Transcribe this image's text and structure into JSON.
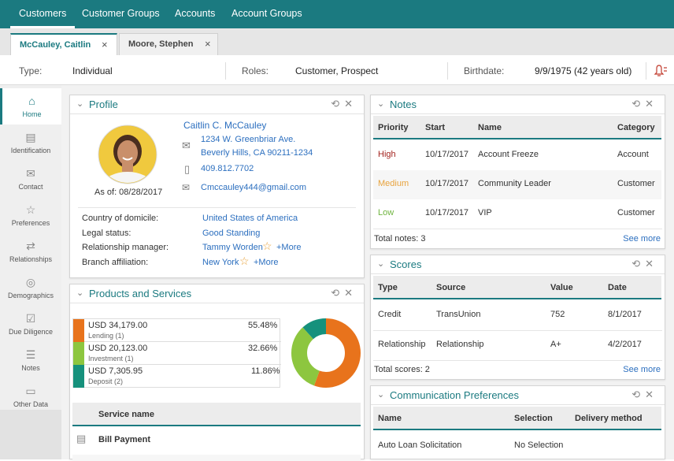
{
  "topnav": {
    "items": [
      "Customers",
      "Customer Groups",
      "Accounts",
      "Account Groups"
    ]
  },
  "record_tabs": [
    {
      "label": "McCauley, Caitlin",
      "close": "×"
    },
    {
      "label": "Moore, Stephen",
      "close": "×"
    }
  ],
  "infobar": {
    "type_label": "Type:",
    "type_value": "Individual",
    "roles_label": "Roles:",
    "roles_value": "Customer, Prospect",
    "birth_label": "Birthdate:",
    "birth_value": "9/9/1975 (42 years old)",
    "alert_icon": "bell-alert-icon"
  },
  "sidebar": {
    "items": [
      {
        "label": "Home",
        "icon": "home-icon"
      },
      {
        "label": "Identification",
        "icon": "id-card-icon"
      },
      {
        "label": "Contact",
        "icon": "address-icon"
      },
      {
        "label": "Preferences",
        "icon": "star-icon"
      },
      {
        "label": "Relationships",
        "icon": "arrows-icon"
      },
      {
        "label": "Demographics",
        "icon": "target-icon"
      },
      {
        "label": "Due Diligence",
        "icon": "checklist-icon"
      },
      {
        "label": "Notes",
        "icon": "notes-icon"
      },
      {
        "label": "Other Data",
        "icon": "folder-icon"
      }
    ]
  },
  "profile": {
    "title": "Profile",
    "name": "Caitlin C. McCauley",
    "address1": "1234 W. Greenbriar Ave.",
    "address2": "Beverly Hills, CA 90211-1234",
    "phone": "409.812.7702",
    "email": "Cmccauley444@gmail.com",
    "as_of": "As of: 08/28/2017",
    "fields": [
      {
        "label": "Country of domicile:",
        "value": "United States of America",
        "more": ""
      },
      {
        "label": "Legal status:",
        "value": "Good Standing",
        "more": ""
      },
      {
        "label": "Relationship manager:",
        "value": "Tammy Worden",
        "more": "+More"
      },
      {
        "label": "Branch affiliation:",
        "value": "New York",
        "more": "+More"
      }
    ]
  },
  "products": {
    "title": "Products and Services",
    "rows": [
      {
        "amount": "USD 34,179.00",
        "sub": "Lending (1)",
        "pct": "55.48%",
        "color": "#e8731c"
      },
      {
        "amount": "USD 20,123.00",
        "sub": "Investment (1)",
        "pct": "32.66%",
        "color": "#8dc63f"
      },
      {
        "amount": "USD 7,305.95",
        "sub": "Deposit (2)",
        "pct": "11.86%",
        "color": "#16917c"
      }
    ],
    "donut_values": [
      55.48,
      32.66,
      11.86
    ],
    "service_header": "Service name",
    "services": [
      "Bill Payment"
    ]
  },
  "notes": {
    "title": "Notes",
    "headers": [
      "Priority",
      "Start",
      "Name",
      "Category"
    ],
    "rows": [
      {
        "priority": "High",
        "start": "10/17/2017",
        "name": "Account Freeze",
        "category": "Account",
        "color": "#a3241f"
      },
      {
        "priority": "Medium",
        "start": "10/17/2017",
        "name": "Community Leader",
        "category": "Customer",
        "color": "#e8a33d"
      },
      {
        "priority": "Low",
        "start": "10/17/2017",
        "name": "VIP",
        "category": "Customer",
        "color": "#6fb43f"
      }
    ],
    "total": "Total notes: 3",
    "see_more": "See more"
  },
  "scores": {
    "title": "Scores",
    "headers": [
      "Type",
      "Source",
      "Value",
      "Date"
    ],
    "rows": [
      {
        "type": "Credit",
        "source": "TransUnion",
        "value": "752",
        "date": "8/1/2017"
      },
      {
        "type": "Relationship",
        "source": "Relationship",
        "value": "A+",
        "date": "4/2/2017"
      }
    ],
    "total": "Total scores: 2",
    "see_more": "See more"
  },
  "comm": {
    "title": "Communication Preferences",
    "headers": [
      "Name",
      "Selection",
      "Delivery method"
    ],
    "rows": [
      {
        "name": "Auto Loan Solicitation",
        "selection": "No Selection",
        "delivery": ""
      }
    ]
  },
  "panel_actions": {
    "refresh": "⟲",
    "close": "✕",
    "collapse": "⌄"
  }
}
